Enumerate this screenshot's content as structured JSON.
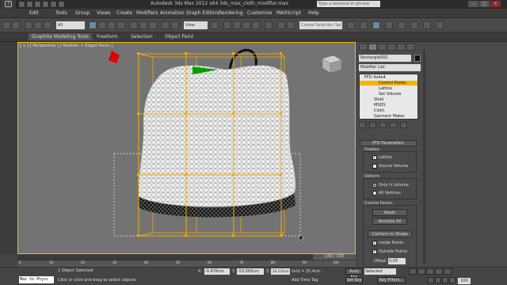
{
  "app": {
    "title": "Autodesk 3ds Max  2012 x64     3ds_max_cloth_modifier.max",
    "logo": "3",
    "search_placeholder": "Type a keyword or phrase"
  },
  "menu": [
    "Edit",
    "Tools",
    "Group",
    "Views",
    "Create",
    "Modifiers",
    "Animation",
    "Graph Editors",
    "Rendering",
    "Customize",
    "MAXScript",
    "Help"
  ],
  "toolbar": {
    "selection_filter": "All",
    "ref_coord": "View",
    "named_selection": "Create Selection Set"
  },
  "ribbon": {
    "tabs": [
      "Graphite Modeling Tools",
      "Freeform",
      "Selection",
      "Object Paint"
    ]
  },
  "viewport": {
    "label": "[ + ] [ Perspective ] [ Realistic + Edged Faces ]"
  },
  "panel": {
    "object_name": "Rectangle002",
    "object_color": "#111111",
    "modifier_list": "Modifier List",
    "stack": [
      {
        "label": "FFD 4x4x4",
        "selected": false,
        "indent": 1
      },
      {
        "label": "Control Points",
        "selected": true,
        "indent": 3
      },
      {
        "label": "Lattice",
        "selected": false,
        "indent": 3
      },
      {
        "label": "Set Volume",
        "selected": false,
        "indent": 3
      },
      {
        "label": "Shell",
        "selected": false,
        "indent": 1
      },
      {
        "label": "MSDS",
        "selected": false,
        "indent": 1
      },
      {
        "label": "Cloth",
        "selected": false,
        "indent": 1
      },
      {
        "label": "Garment Maker",
        "selected": false,
        "indent": 1
      }
    ],
    "rollout_title": "FFD Parameters",
    "display": {
      "group": "Display:",
      "lattice": "Lattice",
      "lattice_checked": true,
      "source_volume": "Source Volume",
      "source_volume_checked": false
    },
    "deform": {
      "group": "Deform:",
      "only_in_volume": "Only In Volume",
      "all_vertices": "All Vertices",
      "selected": "Only In Volume"
    },
    "control_points": {
      "group": "Control Points:",
      "reset": "Reset",
      "animate_all": "Animate All",
      "conform": "Conform to Shape",
      "inside_points": "Inside Points",
      "inside_points_checked": true,
      "outside_points": "Outside Points",
      "outside_points_checked": true,
      "offset_label": "Offset:",
      "offset_value": "0,05"
    }
  },
  "timeline": {
    "slider": "100 / 100",
    "ticks": [
      "0",
      "10",
      "20",
      "30",
      "40",
      "50",
      "60",
      "70",
      "80",
      "90",
      "100"
    ]
  },
  "status": {
    "maxscript": "Max to Physc",
    "selection": "1 Object Selected",
    "prompt": "Click or click-and-drag to select objects",
    "x_label": "X:",
    "x": "-0,476cm",
    "y_label": "Y:",
    "y": "-53,565cm",
    "z_label": "Z:",
    "z": "-16,214cm",
    "grid": "Grid = 25,4cm",
    "time_tag": "Add Time Tag",
    "auto_key": "Auto Key",
    "key_mode": "Selected",
    "set_key": "Set Key",
    "key_filters": "Key Filters...",
    "frame": "100"
  }
}
